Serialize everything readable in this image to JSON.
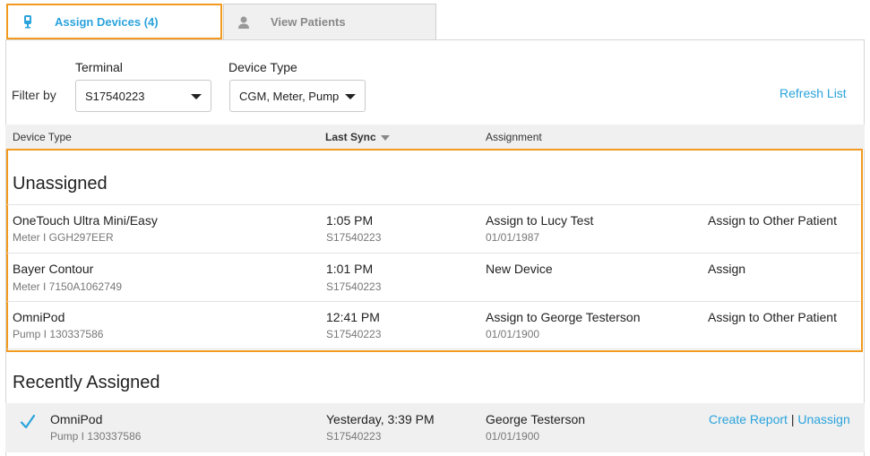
{
  "tabs": {
    "assign": {
      "label": "Assign Devices (4)",
      "icon": "device-icon"
    },
    "patients": {
      "label": "View Patients",
      "icon": "person-icon"
    }
  },
  "filter": {
    "label": "Filter by",
    "terminal_label": "Terminal",
    "terminal_value": "S17540223",
    "device_type_label": "Device Type",
    "device_type_value": "CGM, Meter, Pump",
    "refresh": "Refresh List"
  },
  "columns": {
    "device_type": "Device Type",
    "last_sync": "Last Sync",
    "assignment": "Assignment"
  },
  "unassigned": {
    "title": "Unassigned",
    "rows": [
      {
        "device": "OneTouch Ultra Mini/Easy",
        "detail": "Meter  I  GGH297EER",
        "time": "1:05 PM",
        "terminal": "S17540223",
        "assign": "Assign to Lucy Test",
        "dob": "01/01/1987",
        "other": "Assign to Other Patient"
      },
      {
        "device": "Bayer Contour",
        "detail": "Meter  I  7150A1062749",
        "time": "1:01 PM",
        "terminal": "S17540223",
        "assign": "New Device",
        "dob": "",
        "other": "Assign"
      },
      {
        "device": "OmniPod",
        "detail": "Pump  I  130337586",
        "time": "12:41 PM",
        "terminal": "S17540223",
        "assign": "Assign to George Testerson",
        "dob": "01/01/1900",
        "other": "Assign to Other Patient"
      }
    ]
  },
  "recent": {
    "title": "Recently Assigned",
    "rows": [
      {
        "device": "OmniPod",
        "detail": "Pump  I  130337586",
        "time": "Yesterday, 3:39 PM",
        "terminal": "S17540223",
        "patient": "George Testerson",
        "dob": "01/01/1900",
        "report": "Create Report",
        "separator": "|",
        "unassign": "Unassign"
      }
    ]
  }
}
